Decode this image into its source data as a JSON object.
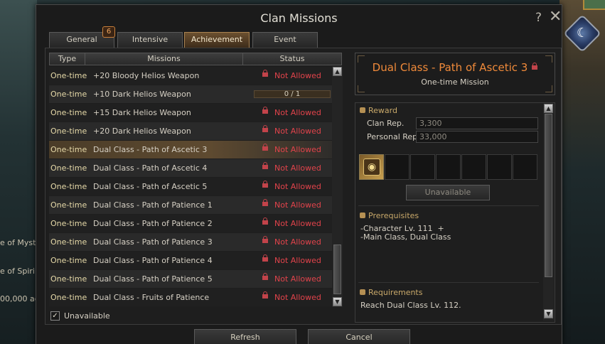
{
  "background": {
    "fragments": [
      "e of Myst",
      "e of Spiri",
      "00,000 ac"
    ]
  },
  "dialog": {
    "title": "Clan Missions",
    "help_glyph": "?",
    "close_glyph": "✕"
  },
  "tabs": [
    {
      "label": "General",
      "badge": "6",
      "active": false
    },
    {
      "label": "Intensive",
      "active": false
    },
    {
      "label": "Achievement",
      "active": true
    },
    {
      "label": "Event",
      "active": false
    }
  ],
  "list": {
    "columns": [
      "Type",
      "Missions",
      "Status"
    ],
    "rows": [
      {
        "type": "One-time",
        "mission": "+20 Bloody Helios Weapon",
        "status": "Not Allowed"
      },
      {
        "type": "One-time",
        "mission": "+10 Dark Helios Weapon",
        "progress": "0 / 1",
        "progress_fraction": 0
      },
      {
        "type": "One-time",
        "mission": "+15 Dark Helios Weapon",
        "status": "Not Allowed"
      },
      {
        "type": "One-time",
        "mission": "+20 Dark Helios Weapon",
        "status": "Not Allowed"
      },
      {
        "type": "One-time",
        "mission": "Dual Class - Path of Ascetic 3",
        "status": "Not Allowed",
        "selected": true
      },
      {
        "type": "One-time",
        "mission": "Dual Class - Path of Ascetic 4",
        "status": "Not Allowed"
      },
      {
        "type": "One-time",
        "mission": "Dual Class - Path of Ascetic 5",
        "status": "Not Allowed"
      },
      {
        "type": "One-time",
        "mission": "Dual Class - Path of Patience 1",
        "status": "Not Allowed"
      },
      {
        "type": "One-time",
        "mission": "Dual Class - Path of Patience 2",
        "status": "Not Allowed"
      },
      {
        "type": "One-time",
        "mission": "Dual Class - Path of Patience 3",
        "status": "Not Allowed"
      },
      {
        "type": "One-time",
        "mission": "Dual Class - Path of Patience 4",
        "status": "Not Allowed"
      },
      {
        "type": "One-time",
        "mission": "Dual Class - Path of Patience 5",
        "status": "Not Allowed"
      },
      {
        "type": "One-time",
        "mission": "Dual Class - Fruits of Patience",
        "status": "Not Allowed"
      }
    ],
    "checkbox": {
      "label": "Unavailable",
      "checked": true,
      "glyph": "✓"
    }
  },
  "detail": {
    "title": "Dual Class - Path of Ascetic 3",
    "subtitle": "One-time Mission",
    "reward": {
      "heading": "Reward",
      "clan_rep_label": "Clan Rep.",
      "clan_rep_value": "3,300",
      "personal_rep_label": "Personal Rep.",
      "personal_rep_value": "33,000",
      "item_icon": "book-icon"
    },
    "unavailable_button": "Unavailable",
    "prerequisites": {
      "heading": "Prerequisites",
      "text": "-Character Lv. 111  +\n-Main Class, Dual Class"
    },
    "requirements": {
      "heading": "Requirements",
      "text": "Reach Dual Class Lv. 112."
    }
  },
  "footer": {
    "refresh": "Refresh",
    "cancel": "Cancel"
  },
  "colors": {
    "accent_orange": "#f08a3a",
    "not_allowed_red": "#e2434b",
    "type_yellow": "#e6d9a8",
    "active_tab": "#6b5030"
  }
}
